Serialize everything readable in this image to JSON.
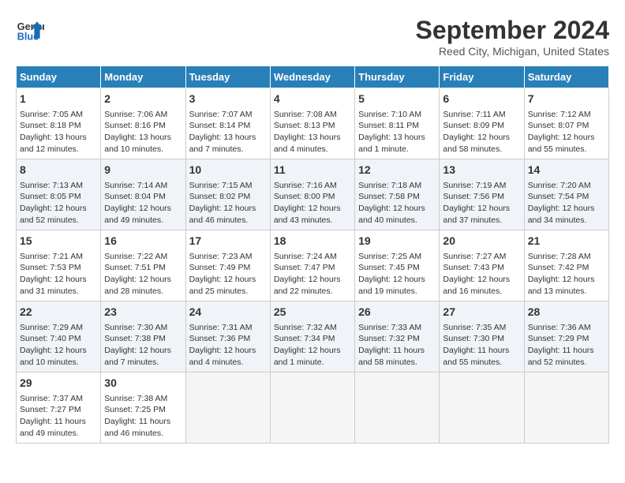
{
  "header": {
    "logo_line1": "General",
    "logo_line2": "Blue",
    "month": "September 2024",
    "location": "Reed City, Michigan, United States"
  },
  "weekdays": [
    "Sunday",
    "Monday",
    "Tuesday",
    "Wednesday",
    "Thursday",
    "Friday",
    "Saturday"
  ],
  "weeks": [
    [
      {
        "day": 1,
        "lines": [
          "Sunrise: 7:05 AM",
          "Sunset: 8:18 PM",
          "Daylight: 13 hours",
          "and 12 minutes."
        ]
      },
      {
        "day": 2,
        "lines": [
          "Sunrise: 7:06 AM",
          "Sunset: 8:16 PM",
          "Daylight: 13 hours",
          "and 10 minutes."
        ]
      },
      {
        "day": 3,
        "lines": [
          "Sunrise: 7:07 AM",
          "Sunset: 8:14 PM",
          "Daylight: 13 hours",
          "and 7 minutes."
        ]
      },
      {
        "day": 4,
        "lines": [
          "Sunrise: 7:08 AM",
          "Sunset: 8:13 PM",
          "Daylight: 13 hours",
          "and 4 minutes."
        ]
      },
      {
        "day": 5,
        "lines": [
          "Sunrise: 7:10 AM",
          "Sunset: 8:11 PM",
          "Daylight: 13 hours",
          "and 1 minute."
        ]
      },
      {
        "day": 6,
        "lines": [
          "Sunrise: 7:11 AM",
          "Sunset: 8:09 PM",
          "Daylight: 12 hours",
          "and 58 minutes."
        ]
      },
      {
        "day": 7,
        "lines": [
          "Sunrise: 7:12 AM",
          "Sunset: 8:07 PM",
          "Daylight: 12 hours",
          "and 55 minutes."
        ]
      }
    ],
    [
      {
        "day": 8,
        "lines": [
          "Sunrise: 7:13 AM",
          "Sunset: 8:05 PM",
          "Daylight: 12 hours",
          "and 52 minutes."
        ]
      },
      {
        "day": 9,
        "lines": [
          "Sunrise: 7:14 AM",
          "Sunset: 8:04 PM",
          "Daylight: 12 hours",
          "and 49 minutes."
        ]
      },
      {
        "day": 10,
        "lines": [
          "Sunrise: 7:15 AM",
          "Sunset: 8:02 PM",
          "Daylight: 12 hours",
          "and 46 minutes."
        ]
      },
      {
        "day": 11,
        "lines": [
          "Sunrise: 7:16 AM",
          "Sunset: 8:00 PM",
          "Daylight: 12 hours",
          "and 43 minutes."
        ]
      },
      {
        "day": 12,
        "lines": [
          "Sunrise: 7:18 AM",
          "Sunset: 7:58 PM",
          "Daylight: 12 hours",
          "and 40 minutes."
        ]
      },
      {
        "day": 13,
        "lines": [
          "Sunrise: 7:19 AM",
          "Sunset: 7:56 PM",
          "Daylight: 12 hours",
          "and 37 minutes."
        ]
      },
      {
        "day": 14,
        "lines": [
          "Sunrise: 7:20 AM",
          "Sunset: 7:54 PM",
          "Daylight: 12 hours",
          "and 34 minutes."
        ]
      }
    ],
    [
      {
        "day": 15,
        "lines": [
          "Sunrise: 7:21 AM",
          "Sunset: 7:53 PM",
          "Daylight: 12 hours",
          "and 31 minutes."
        ]
      },
      {
        "day": 16,
        "lines": [
          "Sunrise: 7:22 AM",
          "Sunset: 7:51 PM",
          "Daylight: 12 hours",
          "and 28 minutes."
        ]
      },
      {
        "day": 17,
        "lines": [
          "Sunrise: 7:23 AM",
          "Sunset: 7:49 PM",
          "Daylight: 12 hours",
          "and 25 minutes."
        ]
      },
      {
        "day": 18,
        "lines": [
          "Sunrise: 7:24 AM",
          "Sunset: 7:47 PM",
          "Daylight: 12 hours",
          "and 22 minutes."
        ]
      },
      {
        "day": 19,
        "lines": [
          "Sunrise: 7:25 AM",
          "Sunset: 7:45 PM",
          "Daylight: 12 hours",
          "and 19 minutes."
        ]
      },
      {
        "day": 20,
        "lines": [
          "Sunrise: 7:27 AM",
          "Sunset: 7:43 PM",
          "Daylight: 12 hours",
          "and 16 minutes."
        ]
      },
      {
        "day": 21,
        "lines": [
          "Sunrise: 7:28 AM",
          "Sunset: 7:42 PM",
          "Daylight: 12 hours",
          "and 13 minutes."
        ]
      }
    ],
    [
      {
        "day": 22,
        "lines": [
          "Sunrise: 7:29 AM",
          "Sunset: 7:40 PM",
          "Daylight: 12 hours",
          "and 10 minutes."
        ]
      },
      {
        "day": 23,
        "lines": [
          "Sunrise: 7:30 AM",
          "Sunset: 7:38 PM",
          "Daylight: 12 hours",
          "and 7 minutes."
        ]
      },
      {
        "day": 24,
        "lines": [
          "Sunrise: 7:31 AM",
          "Sunset: 7:36 PM",
          "Daylight: 12 hours",
          "and 4 minutes."
        ]
      },
      {
        "day": 25,
        "lines": [
          "Sunrise: 7:32 AM",
          "Sunset: 7:34 PM",
          "Daylight: 12 hours",
          "and 1 minute."
        ]
      },
      {
        "day": 26,
        "lines": [
          "Sunrise: 7:33 AM",
          "Sunset: 7:32 PM",
          "Daylight: 11 hours",
          "and 58 minutes."
        ]
      },
      {
        "day": 27,
        "lines": [
          "Sunrise: 7:35 AM",
          "Sunset: 7:30 PM",
          "Daylight: 11 hours",
          "and 55 minutes."
        ]
      },
      {
        "day": 28,
        "lines": [
          "Sunrise: 7:36 AM",
          "Sunset: 7:29 PM",
          "Daylight: 11 hours",
          "and 52 minutes."
        ]
      }
    ],
    [
      {
        "day": 29,
        "lines": [
          "Sunrise: 7:37 AM",
          "Sunset: 7:27 PM",
          "Daylight: 11 hours",
          "and 49 minutes."
        ]
      },
      {
        "day": 30,
        "lines": [
          "Sunrise: 7:38 AM",
          "Sunset: 7:25 PM",
          "Daylight: 11 hours",
          "and 46 minutes."
        ]
      },
      null,
      null,
      null,
      null,
      null
    ]
  ]
}
